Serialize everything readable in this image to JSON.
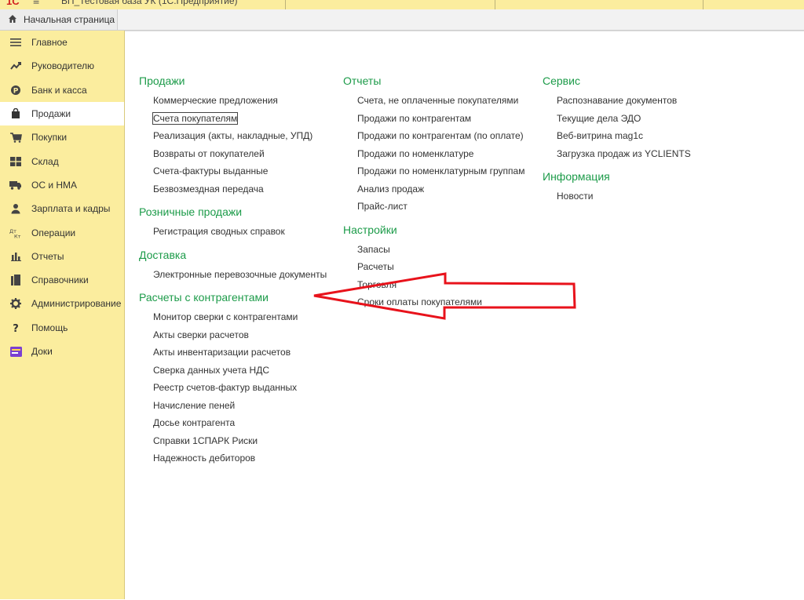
{
  "titlebar": {
    "logo": "1С",
    "menu_glyph": "≡",
    "window_title": "БП_Тестовая база УК (1С:Предприятие)"
  },
  "tabs": {
    "home_label": "Начальная страница"
  },
  "sidebar": {
    "items": [
      {
        "label": "Главное",
        "icon": "menu-icon"
      },
      {
        "label": "Руководителю",
        "icon": "trend-icon"
      },
      {
        "label": "Банк и касса",
        "icon": "coin-icon"
      },
      {
        "label": "Продажи",
        "icon": "bag-icon"
      },
      {
        "label": "Покупки",
        "icon": "cart-icon"
      },
      {
        "label": "Склад",
        "icon": "warehouse-icon"
      },
      {
        "label": "ОС и НМА",
        "icon": "truck-icon"
      },
      {
        "label": "Зарплата и кадры",
        "icon": "person-icon"
      },
      {
        "label": "Операции",
        "icon": "debit-credit-icon"
      },
      {
        "label": "Отчеты",
        "icon": "bar-chart-icon"
      },
      {
        "label": "Справочники",
        "icon": "books-icon"
      },
      {
        "label": "Администрирование",
        "icon": "gear-icon"
      },
      {
        "label": "Помощь",
        "icon": "question-icon"
      },
      {
        "label": "Доки",
        "icon": "folder-icon"
      }
    ],
    "active_index": 3
  },
  "sections": {
    "col1": [
      {
        "title": "Продажи",
        "links": [
          "Коммерческие предложения",
          "Счета покупателям",
          "Реализация (акты, накладные, УПД)",
          "Возвраты от покупателей",
          "Счета-фактуры выданные",
          "Безвозмездная передача"
        ]
      },
      {
        "title": "Розничные продажи",
        "links": [
          "Регистрация сводных справок"
        ]
      },
      {
        "title": "Доставка",
        "links": [
          "Электронные перевозочные документы"
        ]
      },
      {
        "title": "Расчеты с контрагентами",
        "links": [
          "Монитор сверки с контрагентами",
          "Акты сверки расчетов",
          "Акты инвентаризации расчетов",
          "Сверка данных учета НДС",
          "Реестр счетов-фактур выданных",
          "Начисление пеней",
          "Досье контрагента",
          "Справки 1СПАРК Риски",
          "Надежность дебиторов"
        ]
      }
    ],
    "col2": [
      {
        "title": "Отчеты",
        "links": [
          "Счета, не оплаченные покупателями",
          "Продажи по контрагентам",
          "Продажи по контрагентам (по оплате)",
          "Продажи по номенклатуре",
          "Продажи по номенклатурным группам",
          "Анализ продаж",
          "Прайс-лист"
        ]
      },
      {
        "title": "Настройки",
        "links": [
          "Запасы",
          "Расчеты",
          "Торговля",
          "Сроки оплаты покупателями"
        ]
      }
    ],
    "col3": [
      {
        "title": "Сервис",
        "links": [
          "Распознавание документов",
          "Текущие дела ЭДО",
          "Веб-витрина mag1c",
          "Загрузка продаж из YCLIENTS"
        ]
      },
      {
        "title": "Информация",
        "links": [
          "Новости"
        ]
      }
    ]
  },
  "annotation": {
    "arrow_color": "#e8121b"
  }
}
